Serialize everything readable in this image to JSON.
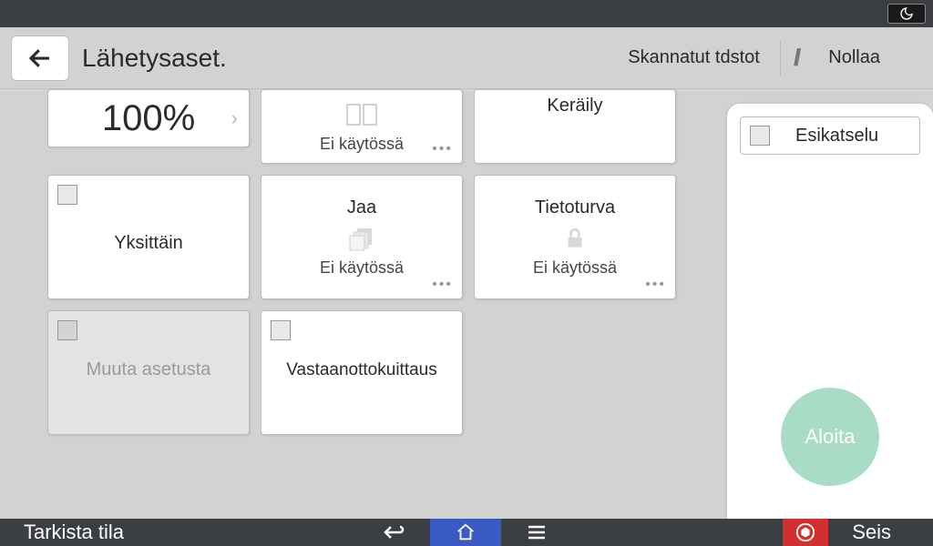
{
  "header": {
    "title": "Lähetysaset.",
    "scanned_files": "Skannatut tdstot",
    "reset": "Nollaa"
  },
  "cards": {
    "zoom": {
      "value": "100%"
    },
    "row0_col1": {
      "footer": "Ei käytössä"
    },
    "row0_col2": {
      "title": "Keräily"
    },
    "row1_col0": {
      "title": "Yksittäin"
    },
    "row1_col1": {
      "title": "Jaa",
      "footer": "Ei käytössä"
    },
    "row1_col2": {
      "title": "Tietoturva",
      "footer": "Ei käytössä"
    },
    "row2_col0": {
      "title": "Muuta asetusta"
    },
    "row2_col1": {
      "title": "Vastaanottokuittaus"
    }
  },
  "right": {
    "preview": "Esikatselu",
    "start": "Aloita"
  },
  "bottom": {
    "check_status": "Tarkista tila",
    "stop": "Seis"
  }
}
